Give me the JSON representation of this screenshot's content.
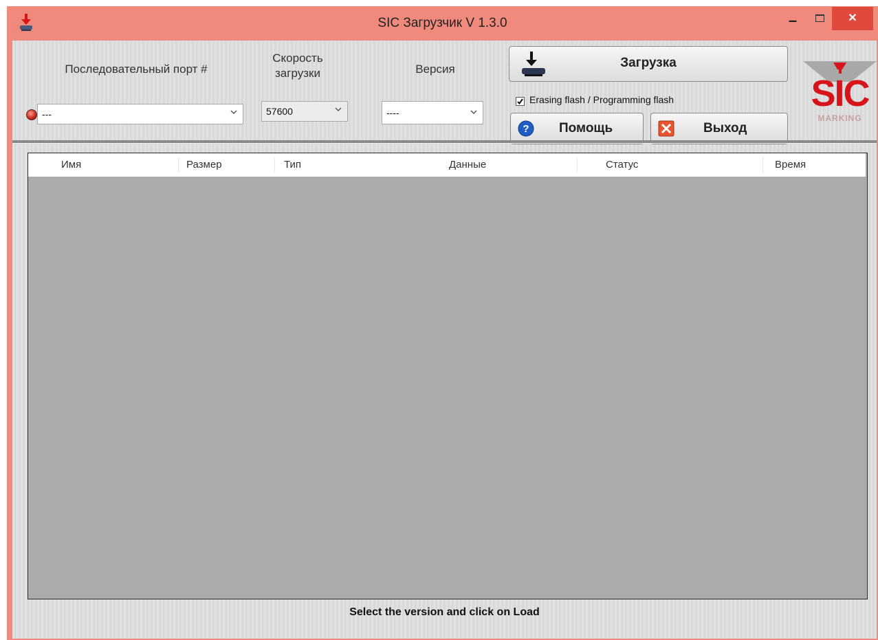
{
  "window": {
    "title": "SIC Загрузчик V 1.3.0",
    "minimize_glyph": "–",
    "close_glyph": "✕"
  },
  "toolbar": {
    "port_label": "Последовательный порт #",
    "speed_label_line1": "Скорость",
    "speed_label_line2": "загрузки",
    "version_label": "Версия",
    "port_value": "---",
    "speed_value": "57600",
    "version_value": "----",
    "load_button": "Загрузка",
    "erase_checkbox_label": "Erasing flash / Programming flash",
    "erase_checked": true,
    "help_button": "Помощь",
    "exit_button": "Выход"
  },
  "logo": {
    "letters": "SIC",
    "subtitle": "MARKING"
  },
  "grid": {
    "columns": [
      "Имя",
      "Размер",
      "Тип",
      "Данные",
      "Статус",
      "Время"
    ],
    "rows": []
  },
  "status_text": "Select the version and click on Load",
  "colors": {
    "titlebar": "#f08a7c",
    "close_button": "#e04a3d",
    "grid_background": "#ababab",
    "logo_red": "#d8141b"
  },
  "icons": [
    "app-download-icon",
    "dropdown-arrow-icon",
    "download-device-icon",
    "help-icon",
    "exit-icon",
    "status-led-icon"
  ]
}
